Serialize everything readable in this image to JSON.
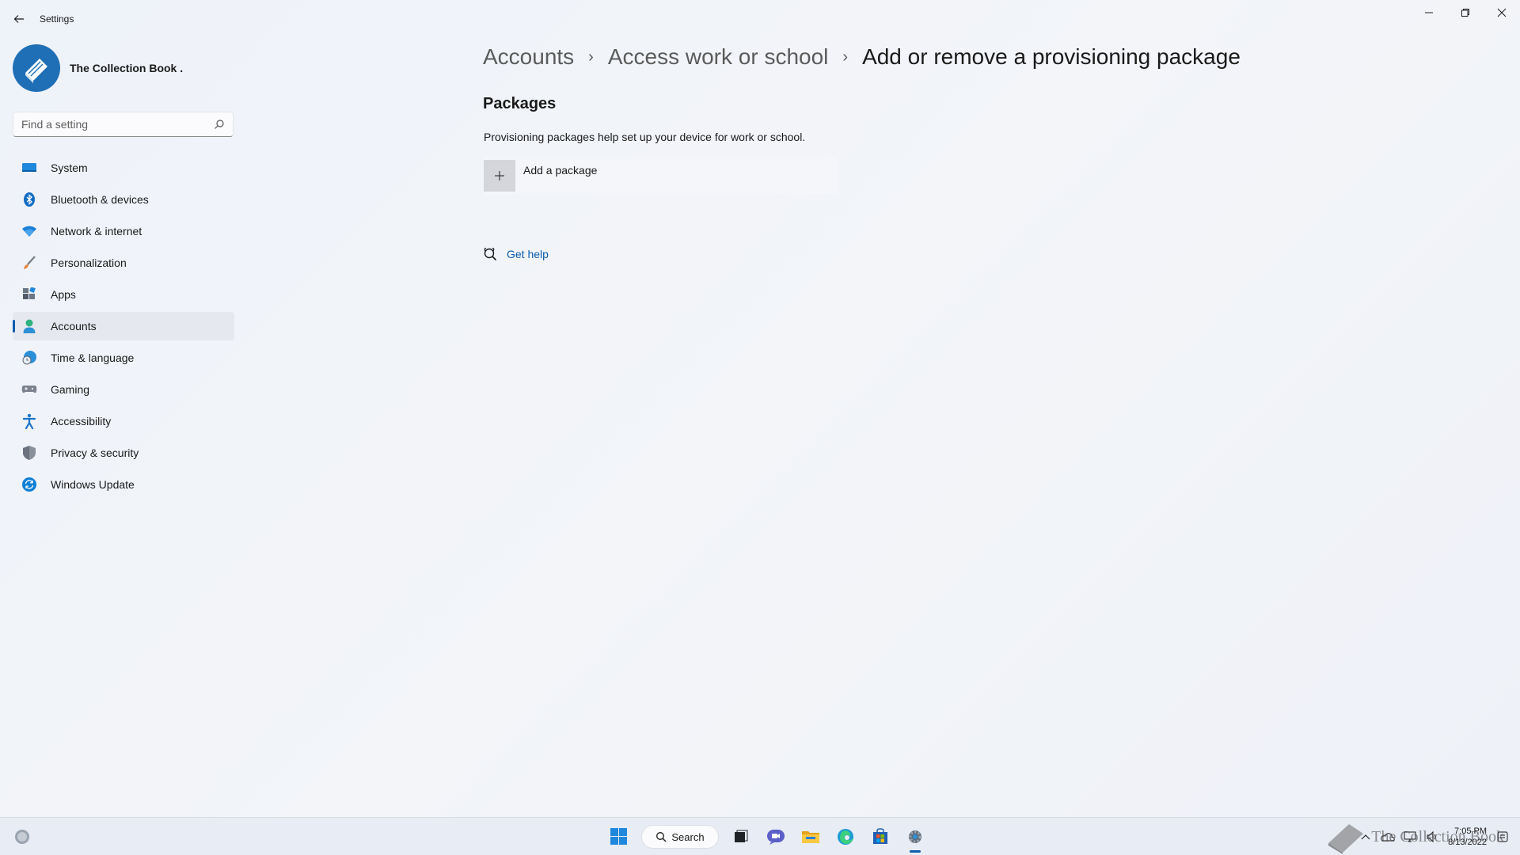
{
  "window": {
    "title": "Settings",
    "controls": [
      "minimize",
      "restore",
      "close"
    ]
  },
  "profile": {
    "name": "The Collection Book ."
  },
  "search": {
    "placeholder": "Find a setting"
  },
  "sidebar": {
    "items": [
      {
        "label": "System",
        "icon": "system-icon",
        "color": "#0078d4"
      },
      {
        "label": "Bluetooth & devices",
        "icon": "bluetooth-icon",
        "color": "#0067c0"
      },
      {
        "label": "Network & internet",
        "icon": "wifi-icon",
        "color": "#0078d4"
      },
      {
        "label": "Personalization",
        "icon": "brush-icon",
        "color": "#e8833a"
      },
      {
        "label": "Apps",
        "icon": "apps-icon",
        "color": "#505a6b"
      },
      {
        "label": "Accounts",
        "icon": "person-icon",
        "color": "#2db37f",
        "active": true
      },
      {
        "label": "Time & language",
        "icon": "globe-clock-icon",
        "color": "#2a8fd9"
      },
      {
        "label": "Gaming",
        "icon": "gamepad-icon",
        "color": "#6b7280"
      },
      {
        "label": "Accessibility",
        "icon": "accessibility-icon",
        "color": "#1a73c9"
      },
      {
        "label": "Privacy & security",
        "icon": "shield-icon",
        "color": "#6b7280"
      },
      {
        "label": "Windows Update",
        "icon": "update-icon",
        "color": "#0f7fd6"
      }
    ]
  },
  "breadcrumb": {
    "items": [
      "Accounts",
      "Access work or school"
    ],
    "current": "Add or remove a provisioning package"
  },
  "packages": {
    "title": "Packages",
    "description": "Provisioning packages help set up your device for work or school.",
    "add_label": "Add a package"
  },
  "help": {
    "label": "Get help"
  },
  "taskbar": {
    "search_label": "Search",
    "time": "7:05 PM",
    "date": "8/13/2022",
    "watermark": "The Collection Book",
    "accent": "#0b5cad"
  }
}
